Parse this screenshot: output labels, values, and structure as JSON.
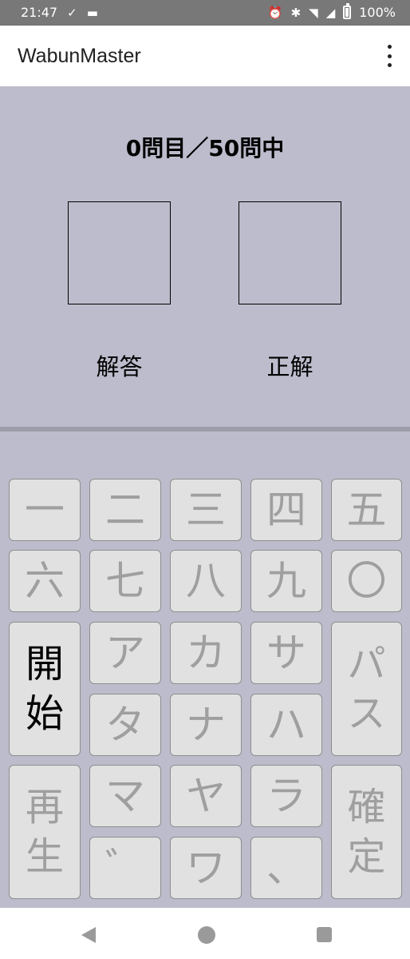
{
  "status_bar": {
    "time": "21:47",
    "battery": "100%",
    "left_icons": [
      "notification-icon",
      "bed-icon"
    ],
    "right_icons": [
      "alarm-icon",
      "bluetooth-icon",
      "wifi-icon",
      "signal-icon",
      "battery-charging-icon"
    ]
  },
  "app_bar": {
    "title": "WabunMaster",
    "menu_icon": "more-vert-icon"
  },
  "quiz": {
    "progress": "0問目／50問中",
    "answer_label": "解答",
    "correct_label": "正解"
  },
  "keyboard": {
    "row1": [
      "一",
      "二",
      "三",
      "四",
      "五"
    ],
    "row2": [
      "六",
      "七",
      "八",
      "九",
      "〇"
    ],
    "start_line1": "開",
    "start_line2": "始",
    "row3": [
      "ア",
      "カ",
      "サ"
    ],
    "pass_line1": "パ",
    "pass_line2": "ス",
    "row4": [
      "タ",
      "ナ",
      "ハ"
    ],
    "replay_line1": "再",
    "replay_line2": "生",
    "row5": [
      "マ",
      "ヤ",
      "ラ"
    ],
    "confirm_line1": "確",
    "confirm_line2": "定",
    "row6": [
      "゛",
      "ワ",
      "、"
    ]
  },
  "nav_bar": {
    "icons": [
      "back-icon",
      "home-icon",
      "recent-apps-icon"
    ]
  }
}
